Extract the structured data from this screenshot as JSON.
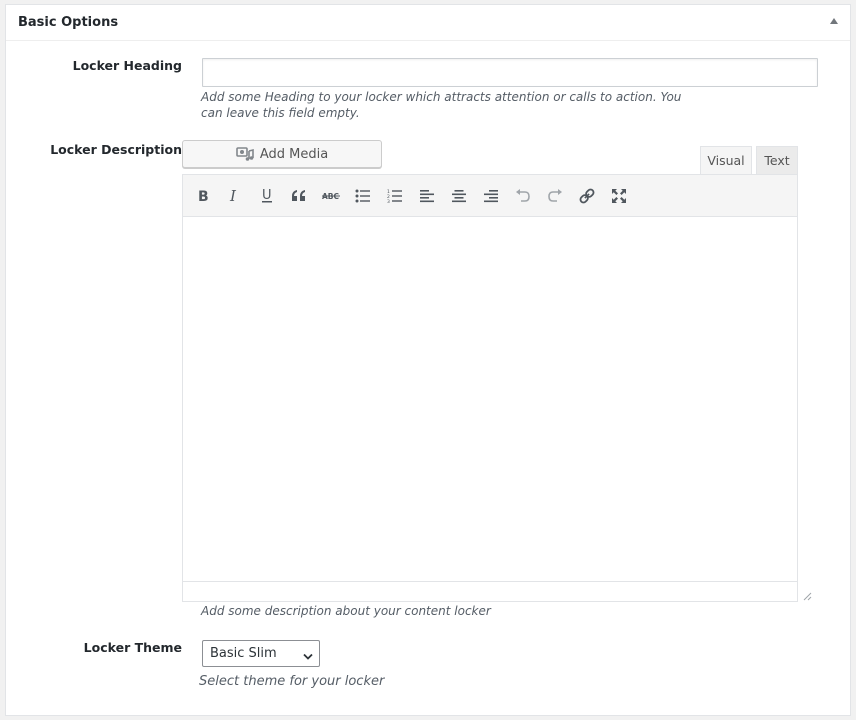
{
  "panel": {
    "title": "Basic Options"
  },
  "heading_field": {
    "label": "Locker Heading",
    "value": "",
    "placeholder": "",
    "description_line1": "Add some Heading to your locker which attracts attention or calls to action. You",
    "description_line2": "can leave this field empty."
  },
  "description_field": {
    "label": "Locker Description",
    "add_media_label": "Add Media",
    "tabs": [
      {
        "label": "Visual",
        "active": true
      },
      {
        "label": "Text",
        "active": false
      }
    ],
    "toolbar_icons": [
      "bold-icon",
      "italic-icon",
      "underline-icon",
      "blockquote-icon",
      "strikethrough-icon",
      "bulleted-list-icon",
      "numbered-list-icon",
      "align-left-icon",
      "align-center-icon",
      "align-right-icon",
      "undo-icon",
      "redo-icon",
      "link-icon",
      "fullscreen-icon"
    ],
    "description": "Add some description about your content locker"
  },
  "theme_field": {
    "label": "Locker Theme",
    "selected": "Basic Slim",
    "description": "Select theme for your locker"
  }
}
